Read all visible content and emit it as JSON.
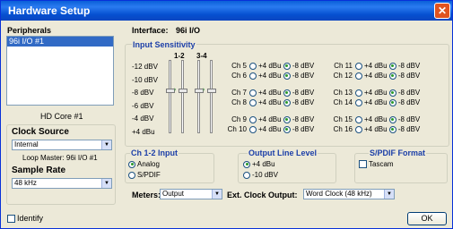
{
  "window": {
    "title": "Hardware Setup",
    "close_glyph": "✕"
  },
  "peripherals": {
    "label": "Peripherals",
    "items": [
      "96i I/O #1"
    ],
    "caption": "HD Core #1"
  },
  "interface": {
    "label": "Interface:",
    "value": "96i I/O"
  },
  "input_sensitivity": {
    "label": "Input Sensitivity",
    "col_12": "1-2",
    "col_34": "3-4",
    "scale": [
      "-12 dBV",
      "-10 dBV",
      "-8 dBV",
      "-6 dBV",
      "-4 dBV",
      "+4 dBu"
    ]
  },
  "radio_opts": {
    "plus4": "+4 dBu",
    "minus8": "-8 dBV"
  },
  "channels": [
    {
      "label": "Ch 5"
    },
    {
      "label": "Ch 6"
    },
    {
      "label": "Ch 7"
    },
    {
      "label": "Ch 8"
    },
    {
      "label": "Ch 9"
    },
    {
      "label": "Ch 10"
    },
    {
      "label": "Ch 11"
    },
    {
      "label": "Ch 12"
    },
    {
      "label": "Ch 13"
    },
    {
      "label": "Ch 14"
    },
    {
      "label": "Ch 15"
    },
    {
      "label": "Ch 16"
    }
  ],
  "clock_source": {
    "label": "Clock Source",
    "value": "Internal",
    "loop_master": "Loop Master: 96i I/O #1"
  },
  "sample_rate": {
    "label": "Sample Rate",
    "value": "48 kHz"
  },
  "ch12_input": {
    "label": "Ch 1-2 Input",
    "opt1": "Analog",
    "opt2": "S/PDIF",
    "selected": "Analog"
  },
  "output_level": {
    "label": "Output Line Level",
    "opt1": "+4 dBu",
    "opt2": "-10 dBV",
    "selected": "+4 dBu"
  },
  "spdif": {
    "label": "S/PDIF Format",
    "tascam": "Tascam",
    "checked": false
  },
  "meters": {
    "label": "Meters:",
    "value": "Output"
  },
  "ext_clock": {
    "label": "Ext. Clock Output:",
    "value": "Word Clock (48 kHz)"
  },
  "identify": {
    "label": "Identify",
    "checked": false
  },
  "ok": {
    "label": "OK"
  }
}
